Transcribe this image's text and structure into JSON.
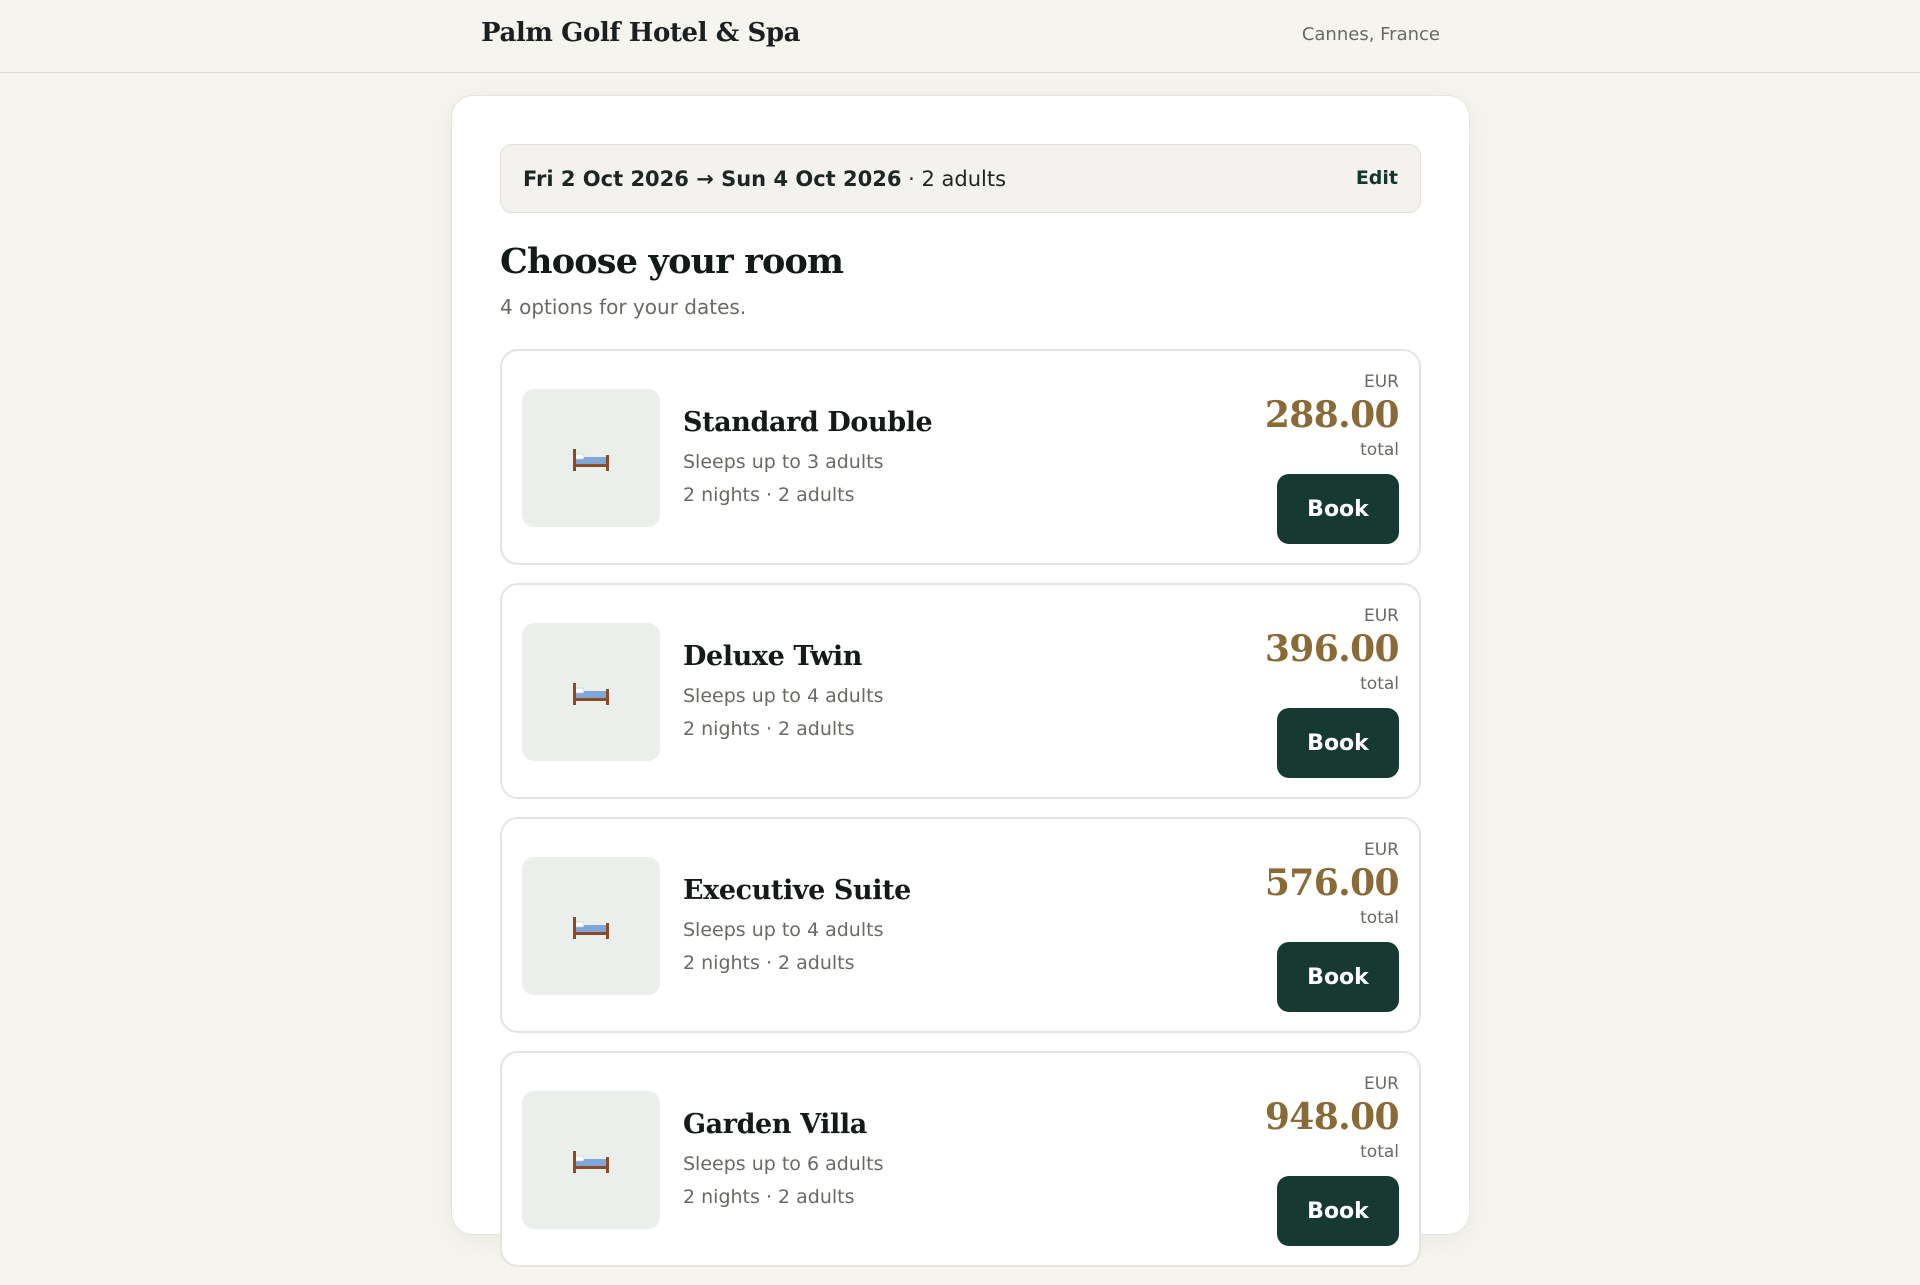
{
  "header": {
    "brand": "Palm Golf Hotel & Spa",
    "location": "Cannes, France"
  },
  "search_summary": {
    "dates": "Fri 2 Oct 2026 → Sun 4 Oct 2026",
    "separator": " · ",
    "guests": "2 adults",
    "edit_label": "Edit"
  },
  "main": {
    "heading": "Choose your room",
    "subheading": "4 options for your dates."
  },
  "rooms": [
    {
      "name": "Standard Double",
      "capacity": "Sleeps up to 3 adults",
      "stay": "2 nights · 2 adults",
      "currency": "EUR",
      "price": "288.00",
      "price_note": "total",
      "book_label": "Book",
      "icon": "bed-icon"
    },
    {
      "name": "Deluxe Twin",
      "capacity": "Sleeps up to 4 adults",
      "stay": "2 nights · 2 adults",
      "currency": "EUR",
      "price": "396.00",
      "price_note": "total",
      "book_label": "Book",
      "icon": "bed-icon"
    },
    {
      "name": "Executive Suite",
      "capacity": "Sleeps up to 4 adults",
      "stay": "2 nights · 2 adults",
      "currency": "EUR",
      "price": "576.00",
      "price_note": "total",
      "book_label": "Book",
      "icon": "bed-icon"
    },
    {
      "name": "Garden Villa",
      "capacity": "Sleeps up to 6 adults",
      "stay": "2 nights · 2 adults",
      "currency": "EUR",
      "price": "948.00",
      "price_note": "total",
      "book_label": "Book",
      "icon": "bed-icon"
    }
  ],
  "colors": {
    "background": "#f5f4ef",
    "accent_button": "#163a32",
    "price": "#8a6a36",
    "thumb_bg": "#ebefec"
  }
}
